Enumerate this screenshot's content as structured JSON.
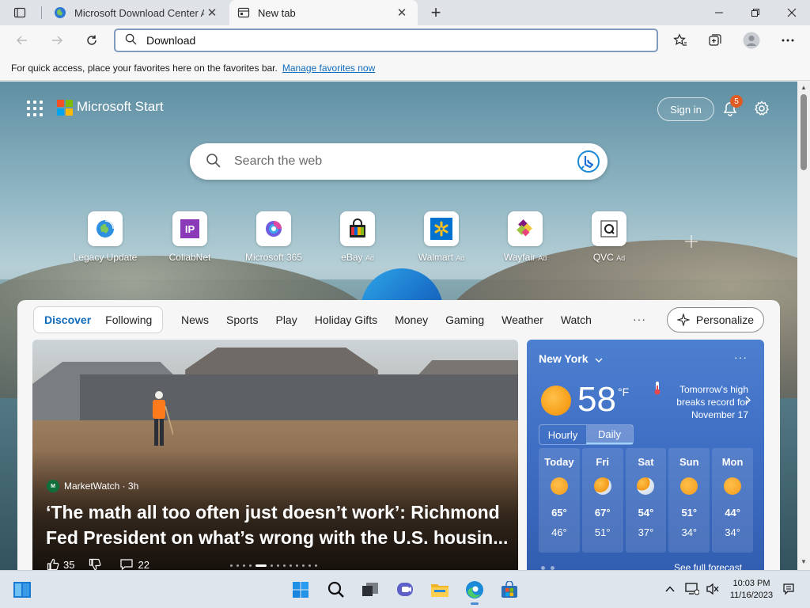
{
  "browser": {
    "tabs": [
      {
        "title": "Microsoft Download Center Ar",
        "active": false
      },
      {
        "title": "New tab",
        "active": true
      }
    ],
    "address_value": "Download",
    "favorites_bar_text": "For quick access, place your favorites here on the favorites bar.",
    "favorites_bar_link": "Manage favorites now"
  },
  "header": {
    "title": "Microsoft Start",
    "sign_in": "Sign in",
    "notification_count": "5"
  },
  "search": {
    "placeholder": "Search the web"
  },
  "tiles": [
    {
      "label": "Legacy Update",
      "ad": ""
    },
    {
      "label": "CollabNet",
      "ad": ""
    },
    {
      "label": "Microsoft 365",
      "ad": ""
    },
    {
      "label": "eBay",
      "ad": "Ad"
    },
    {
      "label": "Walmart",
      "ad": "Ad"
    },
    {
      "label": "Wayfair",
      "ad": "Ad"
    },
    {
      "label": "QVC",
      "ad": "Ad"
    }
  ],
  "feed": {
    "chips": [
      "Discover",
      "Following"
    ],
    "nav": [
      "News",
      "Sports",
      "Play",
      "Holiday Gifts",
      "Money",
      "Gaming",
      "Weather",
      "Watch"
    ],
    "more": "···",
    "personalize": "Personalize"
  },
  "hero": {
    "source": "MarketWatch · 3h",
    "headline_line1": "‘The math all too often just doesn’t work’: Richmond",
    "headline_line2": "Fed President on what’s wrong with the U.S. housin...",
    "likes": "35",
    "comments": "22"
  },
  "weather": {
    "city": "New York",
    "temperature": "58",
    "unit": "°F",
    "alert": "Tomorrow's high breaks record for November 17",
    "toggle": [
      "Hourly",
      "Daily"
    ],
    "days": [
      {
        "name": "Today",
        "high": "65°",
        "low": "46°"
      },
      {
        "name": "Fri",
        "high": "67°",
        "low": "51°"
      },
      {
        "name": "Sat",
        "high": "54°",
        "low": "37°"
      },
      {
        "name": "Sun",
        "high": "51°",
        "low": "34°"
      },
      {
        "name": "Mon",
        "high": "44°",
        "low": "34°"
      }
    ],
    "forecast_link": "See full forecast"
  },
  "taskbar": {
    "time": "10:03 PM",
    "date": "11/16/2023"
  },
  "colors": {
    "accent": "#0f6cbd",
    "ms_red": "#f25022",
    "ms_green": "#7fba00",
    "ms_blue": "#00a4ef",
    "ms_yellow": "#ffb900"
  }
}
